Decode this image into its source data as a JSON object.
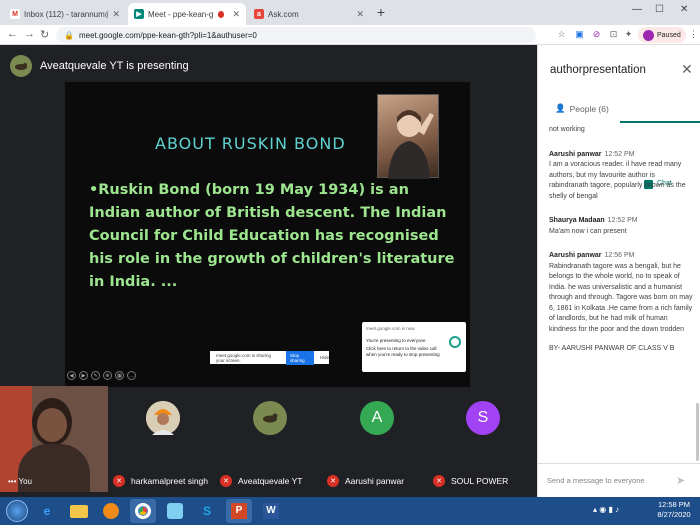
{
  "browser": {
    "tabs": [
      {
        "label": "Inbox (112) - tarannum@theindi",
        "icon": "gmail-icon"
      },
      {
        "label": "Meet - ppe-kean-gth",
        "icon": "meet-icon"
      },
      {
        "label": "Ask.com",
        "icon": "ask-icon"
      }
    ],
    "new_tab": "+",
    "url": "meet.google.com/ppe-kean-gth?pli=1&authuser=0",
    "profile_status": "Paused"
  },
  "meet": {
    "presenter_text": "Aveatquevale YT is presenting",
    "slide": {
      "title": "ABOUT RUSKIN BOND",
      "body": "•Ruskin Bond (born 19 May 1934) is an Indian author of British descent. The Indian Council for Child Education has recognised his role in the growth of children's literature in India. ..."
    },
    "share_notification": {
      "url": "meet.google.com is now",
      "line": "You're presenting to everyone",
      "sub": "Click here to return to the video call when you're ready to stop presenting"
    },
    "share_bar": {
      "text": "meet.google.com is sharing your screen.",
      "stop": "Stop sharing",
      "hide": "Hide"
    },
    "self_label": "You",
    "participants": [
      {
        "name": "harkamalpreet singh",
        "initial": "",
        "color": "#8e7f6a"
      },
      {
        "name": "Aveatquevale YT",
        "initial": "",
        "color": "#7a8a50"
      },
      {
        "name": "Aarushi panwar",
        "initial": "A",
        "color": "#34a853"
      },
      {
        "name": "SOUL POWER",
        "initial": "S",
        "color": "#a142f4"
      }
    ]
  },
  "sidebar": {
    "title": "authorpresentation",
    "tabs": {
      "people": "People (6)",
      "chat": "Chat"
    },
    "messages": [
      {
        "sender": "",
        "time": "",
        "text": "not working"
      },
      {
        "sender": "Aarushi panwar",
        "time": "12:52 PM",
        "text": "I am a voracious  reader. il have read many authors, but my favourite author is rabindranath tagore, popularly known as the shelly of bengal"
      },
      {
        "sender": "Shaurya Madaan",
        "time": "12:52 PM",
        "text": "Ma'am now i can present"
      },
      {
        "sender": "Aarushi panwar",
        "time": "12:56 PM",
        "text": "Rabindranath tagore was a bengali, but he belongs to the whole world, no to speak of India. he was universalistic and a humanist through and through. Tagore was born on may 6, 1861 in Kolkata .He came from a rich family of landlords, but he had milk of human kindness for the poor and the down trodden"
      },
      {
        "sender": "",
        "time": "",
        "text": "BY- AARUSHI PANWAR OF CLASS V B"
      }
    ],
    "input_placeholder": "Send a message to everyone"
  },
  "taskbar": {
    "time": "12:58 PM",
    "date": "8/27/2020"
  }
}
